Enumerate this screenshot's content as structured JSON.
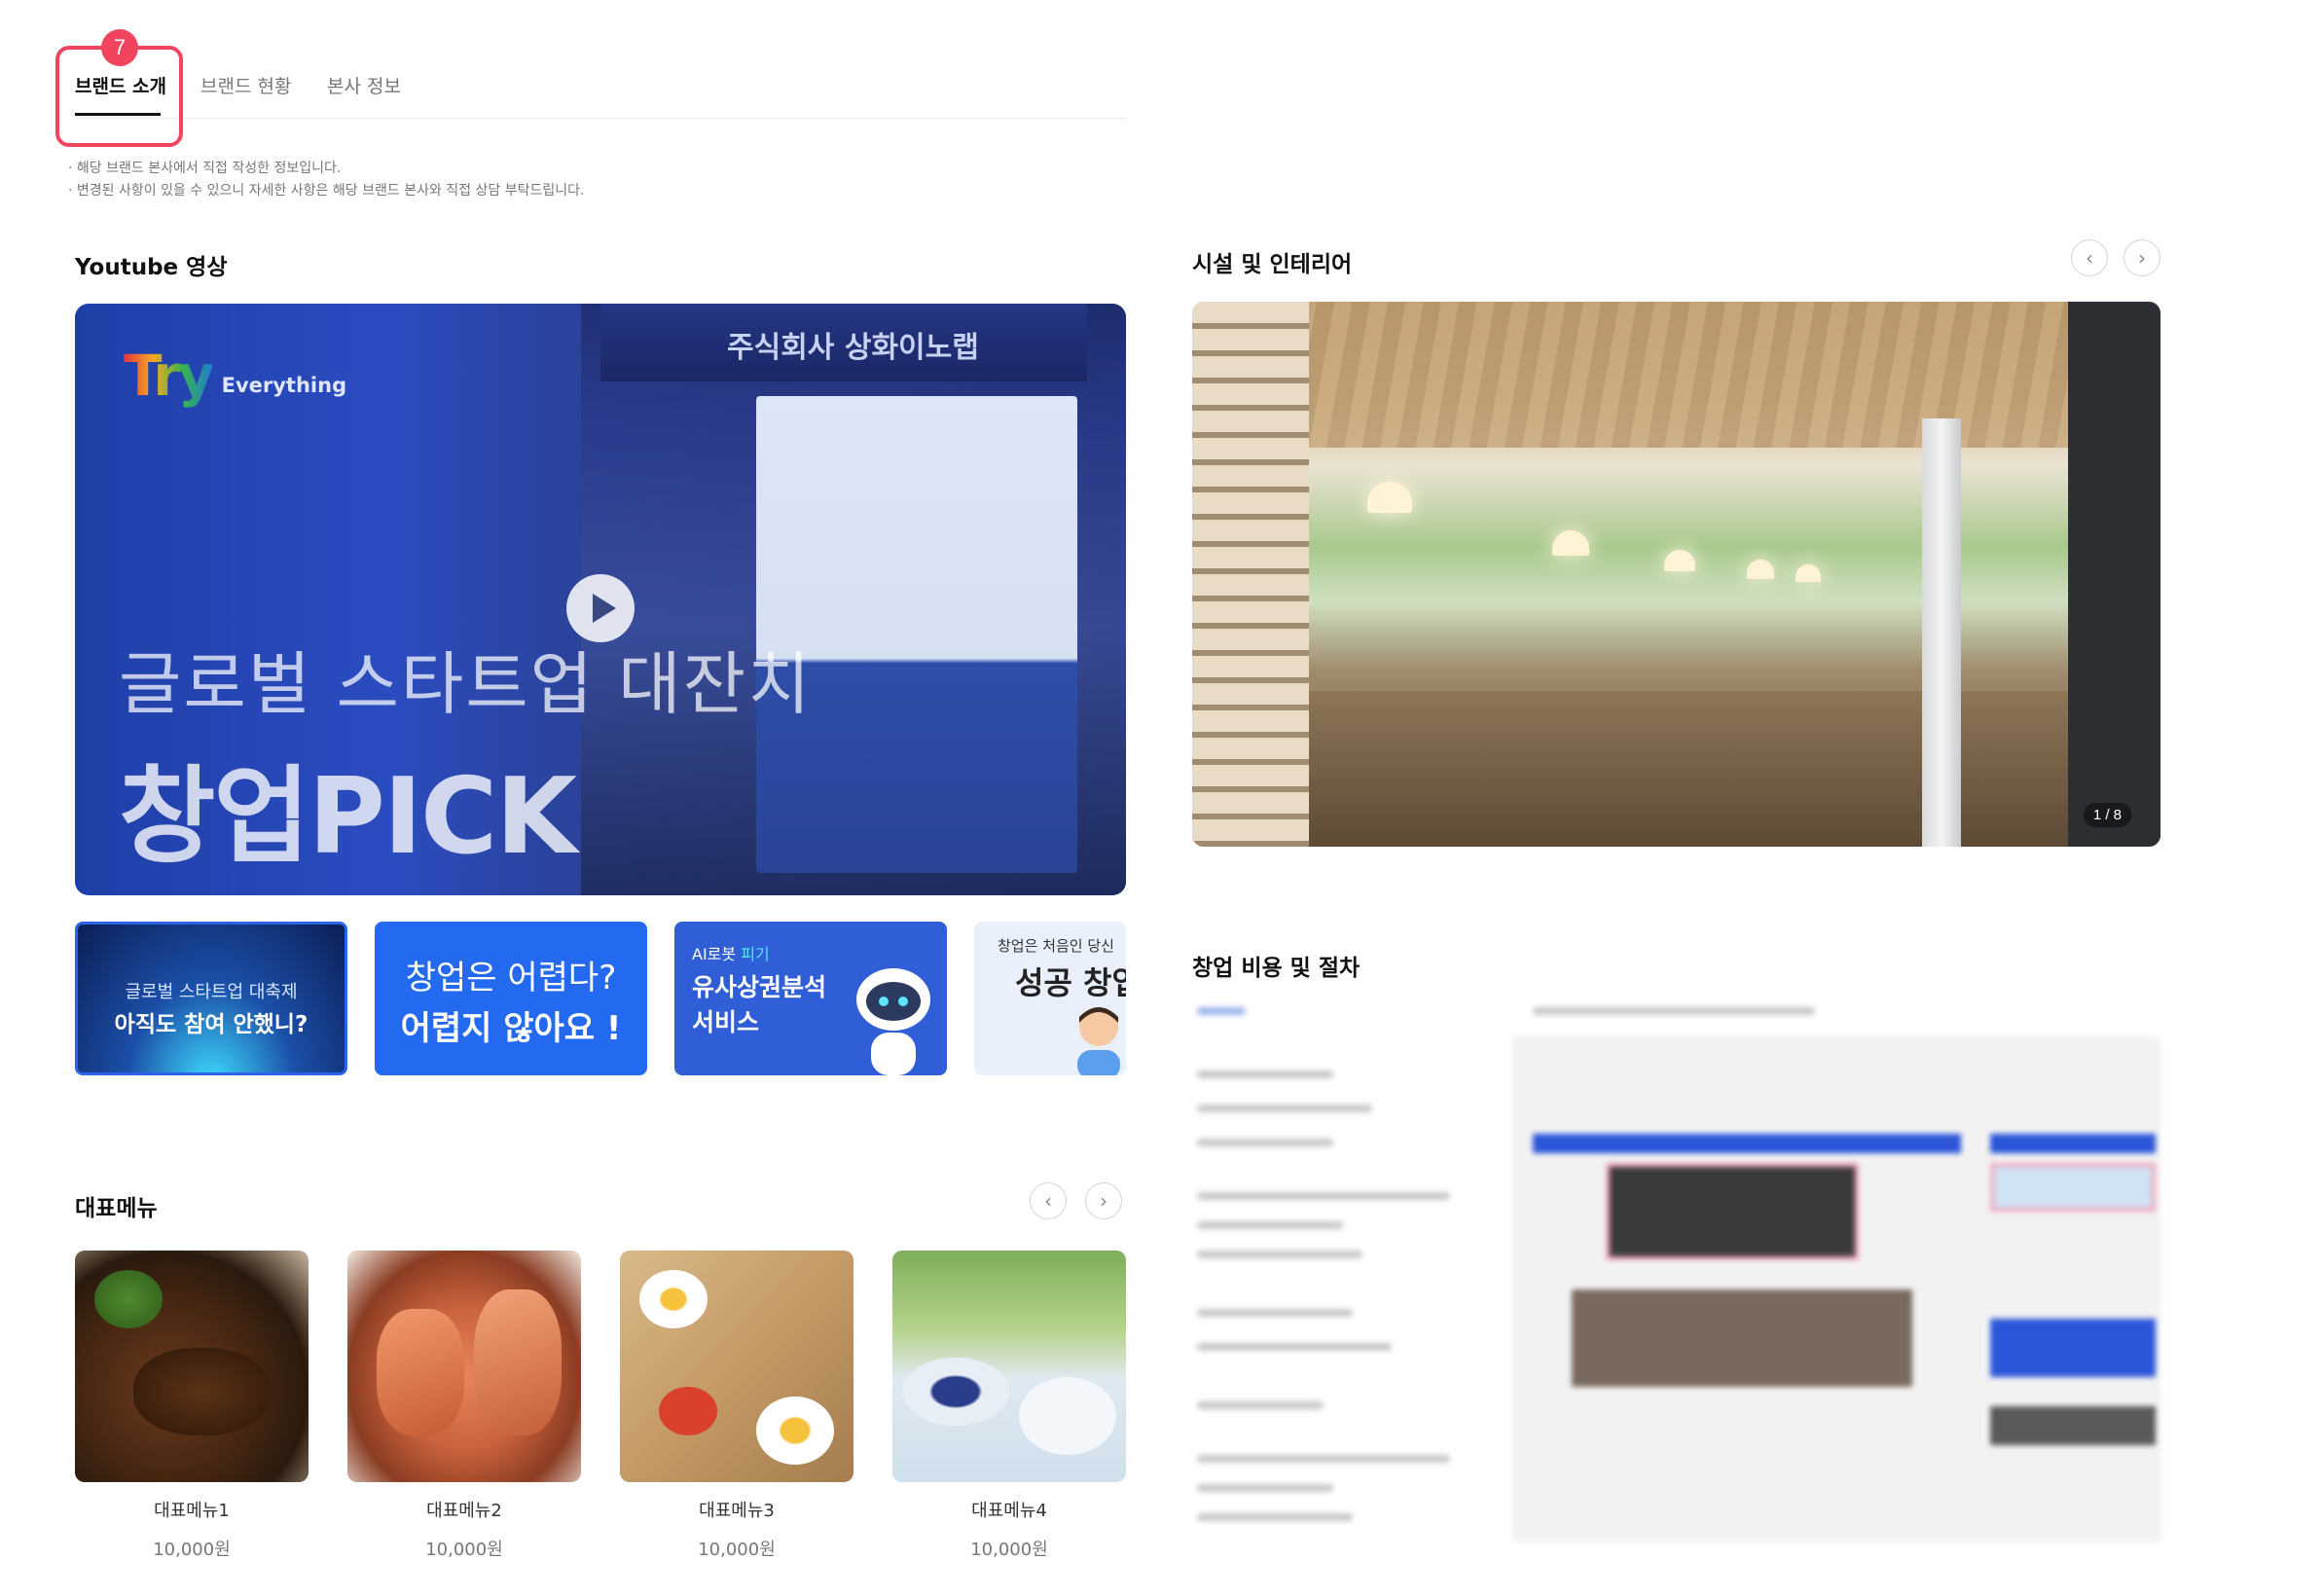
{
  "tabs": {
    "items": [
      {
        "label": "브랜드 소개"
      },
      {
        "label": "브랜드 현황"
      },
      {
        "label": "본사 정보"
      }
    ],
    "badge": "7"
  },
  "notices": [
    "· 해당 브랜드 본사에서 직접 작성한 정보입니다.",
    "· 변경된 사항이 있을 수 있으니 자세한 사항은 해당 브랜드 본사와 직접 상담 부탁드립니다."
  ],
  "youtube": {
    "title": "Youtube 영상",
    "video": {
      "brand_logo": "Try",
      "brand_word": "Everything",
      "sign": "주식회사 상화이노랩",
      "subtitle": "글로벌 스타트업 대잔치",
      "headline": "창업PICK"
    },
    "thumbnails": [
      {
        "line1": "글로벌 스타트업 대축제",
        "line2": "아직도 참여 안했니?"
      },
      {
        "line1": "창업은 어렵다?",
        "line2": "어렵지 않아요 !"
      },
      {
        "tag1": "AI로봇",
        "tag2": "피기",
        "line1": "유사상권분석",
        "line2": "서비스"
      },
      {
        "line1": "창업은 처음인 당신",
        "line2": "성공 창업"
      }
    ]
  },
  "facilities": {
    "title": "시설 및 인테리어",
    "counter": "1 / 8"
  },
  "cost": {
    "title": "창업 비용 및 절차"
  },
  "menu": {
    "title": "대표메뉴",
    "items": [
      {
        "name": "대표메뉴1",
        "price": "10,000원"
      },
      {
        "name": "대표메뉴2",
        "price": "10,000원"
      },
      {
        "name": "대표메뉴3",
        "price": "10,000원"
      },
      {
        "name": "대표메뉴4",
        "price": "10,000원"
      }
    ]
  },
  "icons": {
    "prev": "chevron-left-icon",
    "next": "chevron-right-icon",
    "play": "play-icon"
  },
  "colors": {
    "accent_red": "#f0445f",
    "brand_blue": "#246af0"
  }
}
